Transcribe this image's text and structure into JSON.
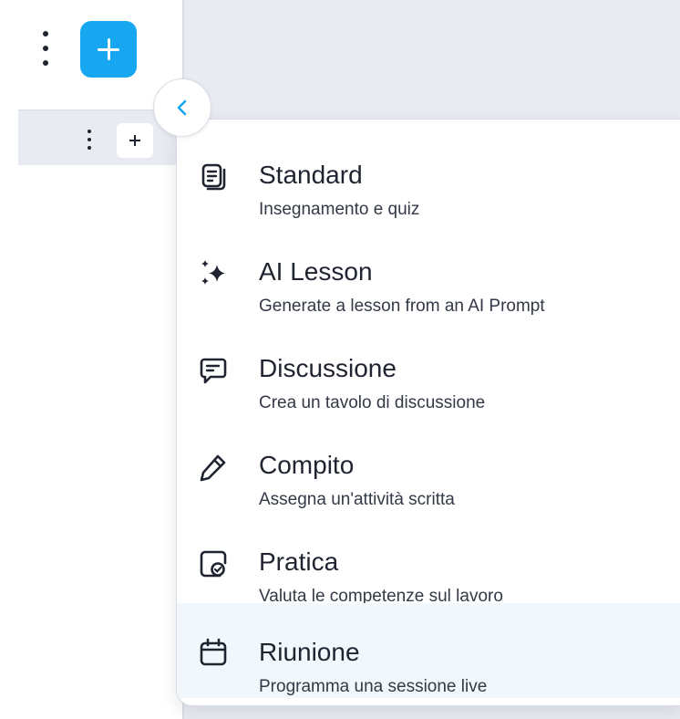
{
  "sidebar": {
    "more_icon": "kebab-vertical-icon",
    "add_icon": "plus-icon",
    "collapse_icon": "chevron-left-icon"
  },
  "colors": {
    "accent": "#17a7f0",
    "pane_bg": "#e9ebf2",
    "highlight": "#f1f7fb",
    "text": "#1f2430"
  },
  "menu": {
    "items": [
      {
        "icon": "document-list-icon",
        "title": "Standard",
        "description": "Insegnamento e quiz"
      },
      {
        "icon": "sparkles-icon",
        "title": "AI Lesson",
        "description": "Generate a lesson from an AI Prompt"
      },
      {
        "icon": "chat-icon",
        "title": "Discussione",
        "description": "Crea un tavolo di discussione"
      },
      {
        "icon": "pencil-icon",
        "title": "Compito",
        "description": "Assegna un'attività scritta"
      },
      {
        "icon": "practice-check-icon",
        "title": "Pratica",
        "description": "Valuta le competenze sul lavoro"
      },
      {
        "icon": "calendar-icon",
        "title": "Riunione",
        "description": "Programma una sessione live"
      }
    ],
    "highlighted_index": 5
  }
}
